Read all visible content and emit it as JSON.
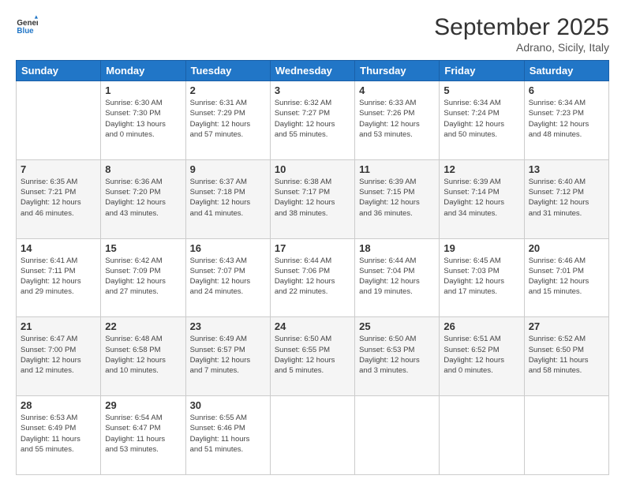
{
  "logo": {
    "text_general": "General",
    "text_blue": "Blue"
  },
  "header": {
    "month": "September 2025",
    "location": "Adrano, Sicily, Italy"
  },
  "weekdays": [
    "Sunday",
    "Monday",
    "Tuesday",
    "Wednesday",
    "Thursday",
    "Friday",
    "Saturday"
  ],
  "weeks": [
    [
      {
        "day": "",
        "info": ""
      },
      {
        "day": "1",
        "info": "Sunrise: 6:30 AM\nSunset: 7:30 PM\nDaylight: 13 hours\nand 0 minutes."
      },
      {
        "day": "2",
        "info": "Sunrise: 6:31 AM\nSunset: 7:29 PM\nDaylight: 12 hours\nand 57 minutes."
      },
      {
        "day": "3",
        "info": "Sunrise: 6:32 AM\nSunset: 7:27 PM\nDaylight: 12 hours\nand 55 minutes."
      },
      {
        "day": "4",
        "info": "Sunrise: 6:33 AM\nSunset: 7:26 PM\nDaylight: 12 hours\nand 53 minutes."
      },
      {
        "day": "5",
        "info": "Sunrise: 6:34 AM\nSunset: 7:24 PM\nDaylight: 12 hours\nand 50 minutes."
      },
      {
        "day": "6",
        "info": "Sunrise: 6:34 AM\nSunset: 7:23 PM\nDaylight: 12 hours\nand 48 minutes."
      }
    ],
    [
      {
        "day": "7",
        "info": "Sunrise: 6:35 AM\nSunset: 7:21 PM\nDaylight: 12 hours\nand 46 minutes."
      },
      {
        "day": "8",
        "info": "Sunrise: 6:36 AM\nSunset: 7:20 PM\nDaylight: 12 hours\nand 43 minutes."
      },
      {
        "day": "9",
        "info": "Sunrise: 6:37 AM\nSunset: 7:18 PM\nDaylight: 12 hours\nand 41 minutes."
      },
      {
        "day": "10",
        "info": "Sunrise: 6:38 AM\nSunset: 7:17 PM\nDaylight: 12 hours\nand 38 minutes."
      },
      {
        "day": "11",
        "info": "Sunrise: 6:39 AM\nSunset: 7:15 PM\nDaylight: 12 hours\nand 36 minutes."
      },
      {
        "day": "12",
        "info": "Sunrise: 6:39 AM\nSunset: 7:14 PM\nDaylight: 12 hours\nand 34 minutes."
      },
      {
        "day": "13",
        "info": "Sunrise: 6:40 AM\nSunset: 7:12 PM\nDaylight: 12 hours\nand 31 minutes."
      }
    ],
    [
      {
        "day": "14",
        "info": "Sunrise: 6:41 AM\nSunset: 7:11 PM\nDaylight: 12 hours\nand 29 minutes."
      },
      {
        "day": "15",
        "info": "Sunrise: 6:42 AM\nSunset: 7:09 PM\nDaylight: 12 hours\nand 27 minutes."
      },
      {
        "day": "16",
        "info": "Sunrise: 6:43 AM\nSunset: 7:07 PM\nDaylight: 12 hours\nand 24 minutes."
      },
      {
        "day": "17",
        "info": "Sunrise: 6:44 AM\nSunset: 7:06 PM\nDaylight: 12 hours\nand 22 minutes."
      },
      {
        "day": "18",
        "info": "Sunrise: 6:44 AM\nSunset: 7:04 PM\nDaylight: 12 hours\nand 19 minutes."
      },
      {
        "day": "19",
        "info": "Sunrise: 6:45 AM\nSunset: 7:03 PM\nDaylight: 12 hours\nand 17 minutes."
      },
      {
        "day": "20",
        "info": "Sunrise: 6:46 AM\nSunset: 7:01 PM\nDaylight: 12 hours\nand 15 minutes."
      }
    ],
    [
      {
        "day": "21",
        "info": "Sunrise: 6:47 AM\nSunset: 7:00 PM\nDaylight: 12 hours\nand 12 minutes."
      },
      {
        "day": "22",
        "info": "Sunrise: 6:48 AM\nSunset: 6:58 PM\nDaylight: 12 hours\nand 10 minutes."
      },
      {
        "day": "23",
        "info": "Sunrise: 6:49 AM\nSunset: 6:57 PM\nDaylight: 12 hours\nand 7 minutes."
      },
      {
        "day": "24",
        "info": "Sunrise: 6:50 AM\nSunset: 6:55 PM\nDaylight: 12 hours\nand 5 minutes."
      },
      {
        "day": "25",
        "info": "Sunrise: 6:50 AM\nSunset: 6:53 PM\nDaylight: 12 hours\nand 3 minutes."
      },
      {
        "day": "26",
        "info": "Sunrise: 6:51 AM\nSunset: 6:52 PM\nDaylight: 12 hours\nand 0 minutes."
      },
      {
        "day": "27",
        "info": "Sunrise: 6:52 AM\nSunset: 6:50 PM\nDaylight: 11 hours\nand 58 minutes."
      }
    ],
    [
      {
        "day": "28",
        "info": "Sunrise: 6:53 AM\nSunset: 6:49 PM\nDaylight: 11 hours\nand 55 minutes."
      },
      {
        "day": "29",
        "info": "Sunrise: 6:54 AM\nSunset: 6:47 PM\nDaylight: 11 hours\nand 53 minutes."
      },
      {
        "day": "30",
        "info": "Sunrise: 6:55 AM\nSunset: 6:46 PM\nDaylight: 11 hours\nand 51 minutes."
      },
      {
        "day": "",
        "info": ""
      },
      {
        "day": "",
        "info": ""
      },
      {
        "day": "",
        "info": ""
      },
      {
        "day": "",
        "info": ""
      }
    ]
  ]
}
